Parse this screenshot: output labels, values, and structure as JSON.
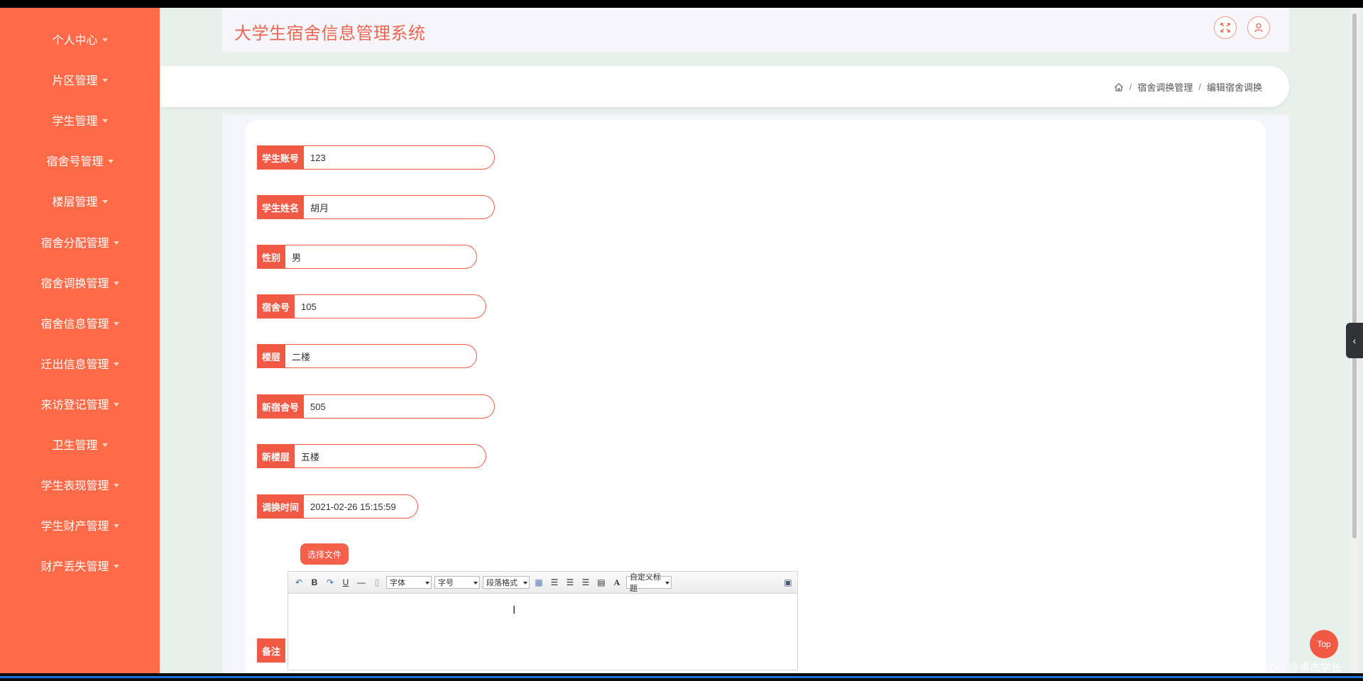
{
  "app": {
    "title": "大学生宿舍信息管理系统"
  },
  "sidebar": {
    "items": [
      {
        "label": "个人中心"
      },
      {
        "label": "片区管理"
      },
      {
        "label": "学生管理"
      },
      {
        "label": "宿舍号管理"
      },
      {
        "label": "楼层管理"
      },
      {
        "label": "宿舍分配管理"
      },
      {
        "label": "宿舍调换管理"
      },
      {
        "label": "宿舍信息管理"
      },
      {
        "label": "迁出信息管理"
      },
      {
        "label": "来访登记管理"
      },
      {
        "label": "卫生管理"
      },
      {
        "label": "学生表现管理"
      },
      {
        "label": "学生财产管理"
      },
      {
        "label": "财产丢失管理"
      }
    ]
  },
  "breadcrumb": {
    "level1": "宿舍调换管理",
    "level2": "编辑宿舍调换"
  },
  "form": {
    "fields": [
      {
        "label": "学生账号",
        "value": "123"
      },
      {
        "label": "学生姓名",
        "value": "胡月"
      },
      {
        "label": "性别",
        "value": "男"
      },
      {
        "label": "宿舍号",
        "value": "105"
      },
      {
        "label": "楼层",
        "value": "二楼"
      },
      {
        "label": "新宿舍号",
        "value": "505"
      },
      {
        "label": "新楼层",
        "value": "五楼"
      },
      {
        "label": "调换时间",
        "value": "2021-02-26 15:15:59"
      }
    ],
    "file_button": "选择文件",
    "remark_label": "备注"
  },
  "editor": {
    "font_select": "字体",
    "size_select": "字号",
    "paragraph_select": "段落格式",
    "custom_title_select": "自定义标题",
    "font_color_glyph": "A"
  },
  "top_button": "Top",
  "watermark": "CSDN @卓杰学长",
  "colors": {
    "accent": "#f05a44",
    "sidebar": "#ff6a48",
    "title": "#e86654"
  }
}
